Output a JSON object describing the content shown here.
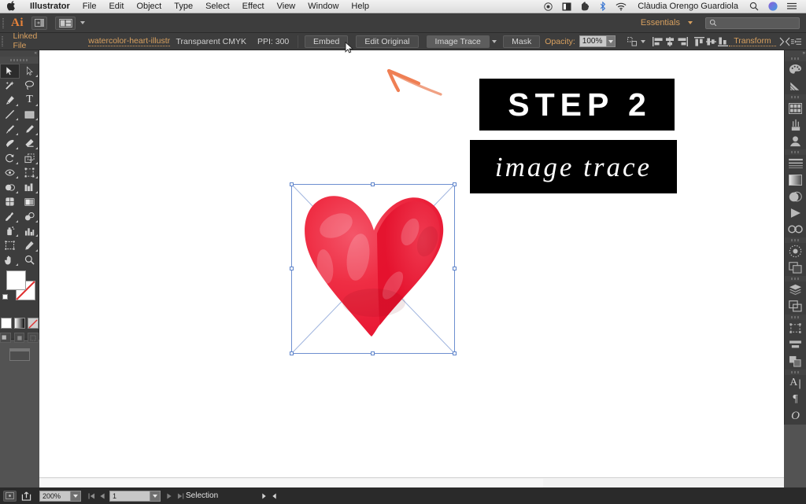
{
  "macmenu": {
    "apple_icon": "apple-icon",
    "items": [
      {
        "label": "Illustrator",
        "bold": true
      },
      {
        "label": "File",
        "bold": false
      },
      {
        "label": "Edit",
        "bold": false
      },
      {
        "label": "Object",
        "bold": false
      },
      {
        "label": "Type",
        "bold": false
      },
      {
        "label": "Select",
        "bold": false
      },
      {
        "label": "Effect",
        "bold": false
      },
      {
        "label": "View",
        "bold": false
      },
      {
        "label": "Window",
        "bold": false
      },
      {
        "label": "Help",
        "bold": false
      }
    ],
    "status_icons": [
      "screen-record-icon",
      "display-icon",
      "evernote-icon",
      "bluetooth-icon",
      "wifi-icon"
    ],
    "user": "Clàudia Orengo Guardiola",
    "right_icons": [
      "spotlight-search-icon",
      "siri-icon",
      "notification-center-icon"
    ]
  },
  "appbar": {
    "logo": "Ai",
    "bridge_icon": "bridge-icon",
    "arrange_icon": "arrange-documents-icon",
    "workspace": "Essentials",
    "workspace_caret": "chevron-down-icon",
    "search_icon": "search-icon",
    "search_placeholder": ""
  },
  "controlbar": {
    "link_status": "Linked File",
    "filename": "watercolor-heart-illustratio...",
    "color_mode": "Transparent CMYK",
    "ppi": "PPI: 300",
    "embed_label": "Embed",
    "edit_original_label": "Edit Original",
    "image_trace_label": "Image Trace",
    "image_trace_caret": "chevron-down-icon",
    "mask_label": "Mask",
    "opacity_label": "Opacity:",
    "opacity_value": "100%",
    "opacity_caret": "chevron-down-icon",
    "align_icons": [
      "align-options-icon",
      "align-left-icon",
      "align-center-horizontal-icon",
      "align-right-icon",
      "align-top-icon",
      "align-middle-vertical-icon",
      "align-bottom-icon"
    ],
    "transform_label": "Transform",
    "shape_icon": "shape-builder-icon",
    "panel_menu_icon": "panel-menu-icon"
  },
  "tools": {
    "panel_title": "tools-panel",
    "collapse_icon": "collapse-panel-icon",
    "items": [
      {
        "name": "selection-tool",
        "selected": true
      },
      {
        "name": "direct-selection-tool",
        "selected": false
      },
      {
        "name": "magic-wand-tool",
        "selected": false
      },
      {
        "name": "lasso-tool",
        "selected": false
      },
      {
        "name": "pen-tool",
        "selected": false
      },
      {
        "name": "type-tool",
        "selected": false
      },
      {
        "name": "line-segment-tool",
        "selected": false
      },
      {
        "name": "rectangle-tool",
        "selected": false
      },
      {
        "name": "paintbrush-tool",
        "selected": false
      },
      {
        "name": "pencil-tool",
        "selected": false
      },
      {
        "name": "blob-brush-tool",
        "selected": false
      },
      {
        "name": "eraser-tool",
        "selected": false
      },
      {
        "name": "rotate-tool",
        "selected": false
      },
      {
        "name": "scale-tool",
        "selected": false
      },
      {
        "name": "width-tool",
        "selected": false
      },
      {
        "name": "free-transform-tool",
        "selected": false
      },
      {
        "name": "shape-builder-tool",
        "selected": false
      },
      {
        "name": "perspective-grid-tool",
        "selected": false
      },
      {
        "name": "mesh-tool",
        "selected": false
      },
      {
        "name": "gradient-tool",
        "selected": false
      },
      {
        "name": "eyedropper-tool",
        "selected": false
      },
      {
        "name": "blend-tool",
        "selected": false
      },
      {
        "name": "symbol-sprayer-tool",
        "selected": false
      },
      {
        "name": "column-graph-tool",
        "selected": false
      },
      {
        "name": "artboard-tool",
        "selected": false
      },
      {
        "name": "slice-tool",
        "selected": false
      },
      {
        "name": "hand-tool",
        "selected": false
      },
      {
        "name": "zoom-tool",
        "selected": false
      }
    ],
    "fill_color": "#ffffff",
    "stroke_color": "#ffffff",
    "stroke_none": true,
    "color_modes": [
      "color-mode-icon",
      "gradient-mode-icon",
      "none-mode-icon"
    ],
    "draw_modes": [
      "draw-normal-icon",
      "draw-behind-icon",
      "draw-inside-icon"
    ],
    "screen_mode": "screen-mode-icon"
  },
  "dock": {
    "collapse_icon": "expand-panels-icon",
    "groups": [
      [
        "color-panel-icon",
        "color-guide-panel-icon"
      ],
      [
        "swatches-panel-icon",
        "brushes-panel-icon",
        "symbols-panel-icon"
      ],
      [
        "stroke-panel-icon",
        "gradient-panel-icon",
        "transparency-panel-icon",
        "appearance-panel-icon",
        "graphic-styles-panel-icon"
      ],
      [
        "brushes-library-panel-icon",
        "links-panel-icon"
      ],
      [
        "layers-panel-icon",
        "artboards-panel-icon"
      ],
      [
        "transform-panel-icon",
        "align-panel-icon",
        "pathfinder-panel-icon"
      ],
      [
        "character-panel-icon",
        "paragraph-panel-icon",
        "glyphs-panel-icon"
      ]
    ]
  },
  "canvas": {
    "step_label": "STEP 2",
    "trace_label": "image trace",
    "artwork_name": "watercolor-heart-illustration",
    "artwork_color": "#ee2737",
    "selection_color": "#6d8fd0",
    "annotation_arrow": "hand-drawn-arrow-icon",
    "annotation_arrow_color": "#f08a63"
  },
  "statusbar": {
    "preview_icon": "preview-mode-icon",
    "share_icon": "share-icon",
    "zoom_level": "200%",
    "zoom_caret": "chevron-down-icon",
    "artboard_first_icon": "first-artboard-icon",
    "artboard_prev_icon": "prev-artboard-icon",
    "artboard_number": "1",
    "artboard_caret": "chevron-down-icon",
    "artboard_next_icon": "next-artboard-icon",
    "artboard_last_icon": "last-artboard-icon",
    "status_text": "Selection",
    "status_caret": "status-menu-icon",
    "scroll_left_icon": "scroll-left-icon"
  }
}
